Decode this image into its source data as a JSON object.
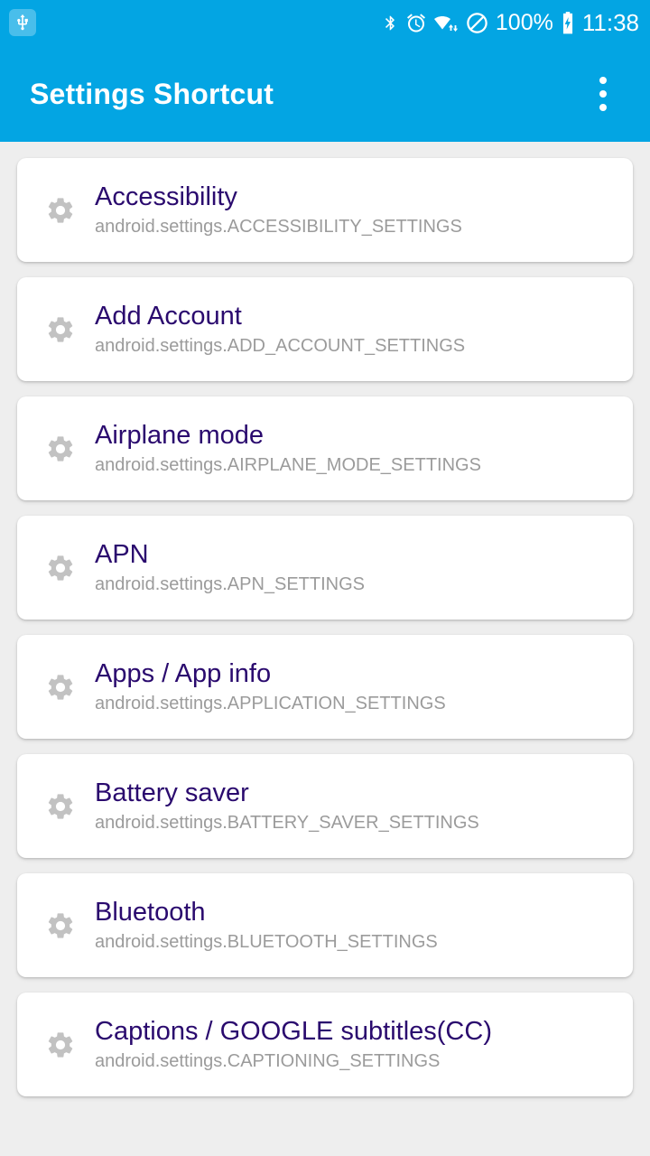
{
  "status_bar": {
    "left_icons": [
      {
        "name": "usb-icon",
        "glyph": "usb"
      }
    ],
    "right_icons": [
      {
        "name": "bluetooth-icon",
        "glyph": "bluetooth"
      },
      {
        "name": "alarm-clock-icon",
        "glyph": "alarm"
      },
      {
        "name": "wifi-icon",
        "glyph": "wifi"
      },
      {
        "name": "do-not-disturb-icon",
        "glyph": "dnd"
      }
    ],
    "battery_percent": "100%",
    "battery_icon": "battery-charging-icon",
    "clock": "11:38"
  },
  "app_bar": {
    "title": "Settings Shortcut",
    "overflow_label": "More options",
    "background_color": "#03A5E3",
    "title_color": "#FFFFFF"
  },
  "theme": {
    "accent": "#03A5E3",
    "page_background": "#EEEEEE",
    "card_background": "#FFFFFF",
    "title_color": "#2A0A6E",
    "subtitle_color": "#9B9B9B",
    "icon_color": "#BDBDBD"
  },
  "list": {
    "items": [
      {
        "title": "Accessibility",
        "action": "android.settings.ACCESSIBILITY_SETTINGS",
        "icon": "gear-icon"
      },
      {
        "title": "Add Account",
        "action": "android.settings.ADD_ACCOUNT_SETTINGS",
        "icon": "gear-icon"
      },
      {
        "title": "Airplane mode",
        "action": "android.settings.AIRPLANE_MODE_SETTINGS",
        "icon": "gear-icon"
      },
      {
        "title": "APN",
        "action": "android.settings.APN_SETTINGS",
        "icon": "gear-icon"
      },
      {
        "title": "Apps / App info",
        "action": "android.settings.APPLICATION_SETTINGS",
        "icon": "gear-icon"
      },
      {
        "title": "Battery saver",
        "action": "android.settings.BATTERY_SAVER_SETTINGS",
        "icon": "gear-icon"
      },
      {
        "title": "Bluetooth",
        "action": "android.settings.BLUETOOTH_SETTINGS",
        "icon": "gear-icon"
      },
      {
        "title": "Captions / GOOGLE subtitles(CC)",
        "action": "android.settings.CAPTIONING_SETTINGS",
        "icon": "gear-icon"
      }
    ]
  }
}
